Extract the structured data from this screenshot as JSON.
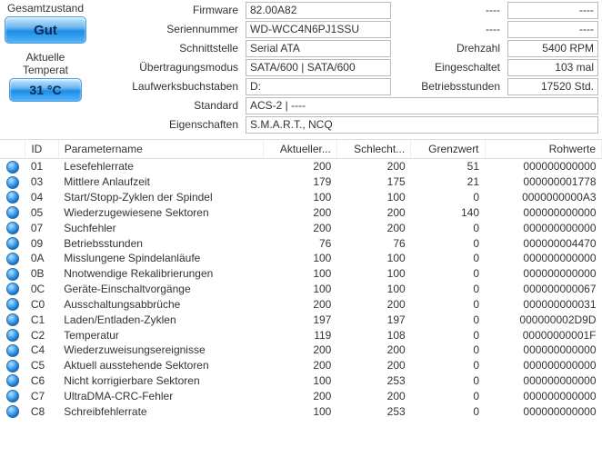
{
  "status": {
    "overall_label": "Gesamtzustand",
    "overall_value": "Gut",
    "temp_label": "Aktuelle Temperat",
    "temp_value": "31 °C"
  },
  "info": {
    "firmware_label": "Firmware",
    "firmware_value": "82.00A82",
    "serial_label": "Seriennummer",
    "serial_value": "WD-WCC4N6PJ1SSU",
    "interface_label": "Schnittstelle",
    "interface_value": "Serial ATA",
    "rpm_label": "Drehzahl",
    "rpm_value": "5400 RPM",
    "transfer_label": "Übertragungsmodus",
    "transfer_value": "SATA/600 | SATA/600",
    "power_label": "Eingeschaltet",
    "power_value": "103 mal",
    "drive_label": "Laufwerksbuchstaben",
    "drive_value": "D:",
    "hours_label": "Betriebsstunden",
    "hours_value": "17520 Std.",
    "standard_label": "Standard",
    "standard_value": "ACS-2 | ----",
    "features_label": "Eigenschaften",
    "features_value": "S.M.A.R.T., NCQ",
    "blank_label": "----",
    "blank_value": "----"
  },
  "table": {
    "headers": {
      "id": "ID",
      "name": "Parametername",
      "current": "Aktueller...",
      "worst": "Schlecht...",
      "threshold": "Grenzwert",
      "raw": "Rohwerte"
    },
    "rows": [
      {
        "id": "01",
        "name": "Lesefehlerrate",
        "cur": "200",
        "worst": "200",
        "thr": "51",
        "raw": "000000000000"
      },
      {
        "id": "03",
        "name": "Mittlere Anlaufzeit",
        "cur": "179",
        "worst": "175",
        "thr": "21",
        "raw": "000000001778"
      },
      {
        "id": "04",
        "name": "Start/Stopp-Zyklen der Spindel",
        "cur": "100",
        "worst": "100",
        "thr": "0",
        "raw": "0000000000A3"
      },
      {
        "id": "05",
        "name": "Wiederzugewiesene Sektoren",
        "cur": "200",
        "worst": "200",
        "thr": "140",
        "raw": "000000000000"
      },
      {
        "id": "07",
        "name": "Suchfehler",
        "cur": "200",
        "worst": "200",
        "thr": "0",
        "raw": "000000000000"
      },
      {
        "id": "09",
        "name": "Betriebsstunden",
        "cur": "76",
        "worst": "76",
        "thr": "0",
        "raw": "000000004470"
      },
      {
        "id": "0A",
        "name": "Misslungene Spindelanläufe",
        "cur": "100",
        "worst": "100",
        "thr": "0",
        "raw": "000000000000"
      },
      {
        "id": "0B",
        "name": "Nnotwendige Rekalibrierungen",
        "cur": "100",
        "worst": "100",
        "thr": "0",
        "raw": "000000000000"
      },
      {
        "id": "0C",
        "name": "Geräte-Einschaltvorgänge",
        "cur": "100",
        "worst": "100",
        "thr": "0",
        "raw": "000000000067"
      },
      {
        "id": "C0",
        "name": "Ausschaltungsabbrüche",
        "cur": "200",
        "worst": "200",
        "thr": "0",
        "raw": "000000000031"
      },
      {
        "id": "C1",
        "name": "Laden/Entladen-Zyklen",
        "cur": "197",
        "worst": "197",
        "thr": "0",
        "raw": "000000002D9D"
      },
      {
        "id": "C2",
        "name": "Temperatur",
        "cur": "119",
        "worst": "108",
        "thr": "0",
        "raw": "00000000001F"
      },
      {
        "id": "C4",
        "name": "Wiederzuweisungsereignisse",
        "cur": "200",
        "worst": "200",
        "thr": "0",
        "raw": "000000000000"
      },
      {
        "id": "C5",
        "name": "Aktuell ausstehende Sektoren",
        "cur": "200",
        "worst": "200",
        "thr": "0",
        "raw": "000000000000"
      },
      {
        "id": "C6",
        "name": "Nicht korrigierbare Sektoren",
        "cur": "100",
        "worst": "253",
        "thr": "0",
        "raw": "000000000000"
      },
      {
        "id": "C7",
        "name": "UltraDMA-CRC-Fehler",
        "cur": "200",
        "worst": "200",
        "thr": "0",
        "raw": "000000000000"
      },
      {
        "id": "C8",
        "name": "Schreibfehlerrate",
        "cur": "100",
        "worst": "253",
        "thr": "0",
        "raw": "000000000000"
      }
    ]
  }
}
